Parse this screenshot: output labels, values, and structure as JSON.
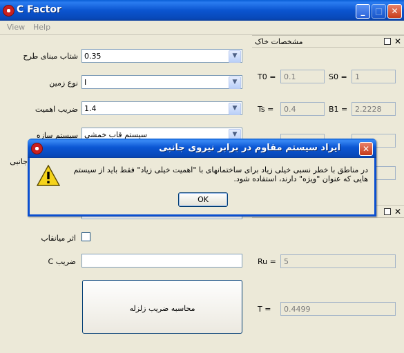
{
  "window": {
    "title": "C Factor"
  },
  "menu": {
    "view": "View",
    "help": "Help"
  },
  "left": {
    "acceleration_label": "شتاب مبنای طرح",
    "acceleration_value": "0.35",
    "soil_type_label": "نوع زمین",
    "soil_type_value": "I",
    "importance_label": "ضریب اهمیت",
    "importance_value": "1.4",
    "system_label": "سیستم سازه",
    "system_value": "سیستم قاب خمشی",
    "lateral_label_fragment": "جانبی",
    "damper_label": "اثر میانقاب",
    "c_label": "ضریب C",
    "calc_button": "محاسبه ضریب زلزله"
  },
  "soil_panel": {
    "title": "مشخصات خاک",
    "t0_label": "T0 =",
    "t0_value": "0.1",
    "s0_label": "S0 =",
    "s0_value": "1",
    "ts_label": "Ts =",
    "ts_value": "0.4",
    "b1_label": "B1 =",
    "b1_value": "2.2228"
  },
  "results": {
    "ru_label": "Ru =",
    "ru_value": "5",
    "t_label": "T =",
    "t_value": "0.4499"
  },
  "dialog": {
    "title": "ایراد سیستم مقاوم در برابر نیروی جانبی",
    "message_line1": "در مناطق با خطر نسبی خیلی زیاد برای ساختمانهای با \"اهمیت خیلی زیاد\" فقط باید از سیستم",
    "message_line2": "هایی که عنوان \"ویژه\" دارند، استفاده شود.",
    "ok_label": "OK"
  },
  "icons": {
    "app": "app-logo-icon",
    "warning": "warning-icon",
    "combo_arrow": "chevron-down-icon"
  }
}
